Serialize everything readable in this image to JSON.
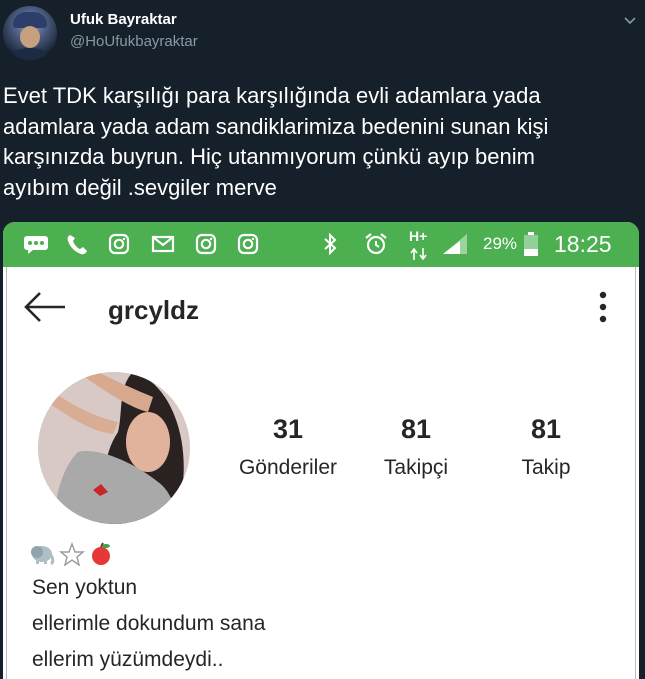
{
  "tweet": {
    "display_name": "Ufuk Bayraktar",
    "handle": "@HoUfukbayraktar",
    "text": "Evet TDK karşılığı para karşılığında evli adamlara yada\nadamlara yada adam sandiklarimiza bedenini sunan kişi\nkarşınızda buyrun. Hiç utanmıyorum çünkü ayıp benim\nayıbım değil .sevgiler merve"
  },
  "status_bar": {
    "network": "H+",
    "battery": "29%",
    "time": "18:25",
    "color": "#4caf50",
    "notification_icons": [
      "message-icon",
      "phone-icon",
      "instagram-icon",
      "mail-icon",
      "instagram-icon",
      "instagram-icon"
    ],
    "system_icons": [
      "bluetooth-icon",
      "alarm-icon",
      "signal-icon",
      "battery-icon"
    ]
  },
  "instagram": {
    "username": "grcyldz",
    "stats": [
      {
        "value": "31",
        "label": "Gönderiler"
      },
      {
        "value": "81",
        "label": "Takipçi"
      },
      {
        "value": "81",
        "label": "Takip"
      }
    ],
    "bio_emoji": [
      "elephant",
      "star",
      "apple"
    ],
    "bio_lines": [
      "Sen yoktun",
      "ellerimle dokundum sana",
      "ellerim yüzümdeydi.."
    ]
  },
  "colors": {
    "background": "#15202b",
    "secondary_text": "#8899a6",
    "status_green": "#4caf50"
  }
}
